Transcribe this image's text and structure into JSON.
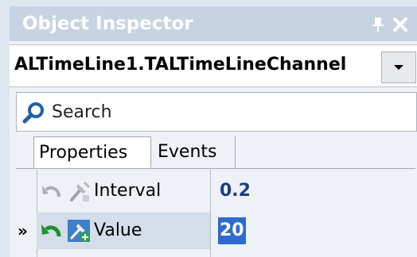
{
  "panel": {
    "title": "Object Inspector"
  },
  "object_selector": {
    "value": "ALTimeLine1.TALTimeLineChannel"
  },
  "search": {
    "placeholder": "Search"
  },
  "tabs": [
    {
      "label": "Properties",
      "active": true
    },
    {
      "label": "Events",
      "active": false
    }
  ],
  "properties": [
    {
      "name": "Interval",
      "value": "0.2",
      "icon": "property-icon",
      "revert_icon": "undo-icon",
      "current": false
    },
    {
      "name": "Value",
      "value": "20",
      "icon": "property-new-icon",
      "revert_icon": "undo-icon-green",
      "current": true,
      "marker": "»"
    }
  ],
  "colors": {
    "title_bar": "#c6d3e2",
    "selection": "#2d6bd1",
    "value_text": "#1e3a8a"
  }
}
